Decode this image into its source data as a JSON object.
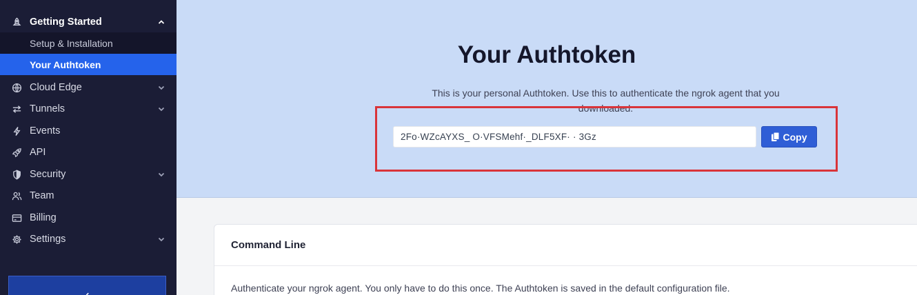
{
  "sidebar": {
    "section": {
      "label": "Getting Started",
      "icon": "rocket-icon"
    },
    "sub_items": [
      {
        "label": "Setup & Installation"
      },
      {
        "label": "Your Authtoken"
      }
    ],
    "items": [
      {
        "label": "Cloud Edge",
        "icon": "globe-icon"
      },
      {
        "label": "Tunnels",
        "icon": "arrows-icon"
      },
      {
        "label": "Events",
        "icon": "bolt-icon"
      },
      {
        "label": "API",
        "icon": "rocket-icon"
      },
      {
        "label": "Security",
        "icon": "shield-icon"
      },
      {
        "label": "Team",
        "icon": "team-icon"
      },
      {
        "label": "Billing",
        "icon": "card-icon"
      },
      {
        "label": "Settings",
        "icon": "gear-icon"
      }
    ]
  },
  "hero": {
    "title": "Your Authtoken",
    "description": "This is your personal Authtoken. Use this to authenticate the ngrok agent that you downloaded.",
    "token_value": "2Fo·WZcAYXS_          O·VFSMehf·_DLF5XF·     ·        3Gz",
    "copy_label": "Copy"
  },
  "card": {
    "title": "Command Line",
    "text": "Authenticate your ngrok agent. You only have to do this once. The Authtoken is saved in the default configuration file."
  },
  "colors": {
    "sidebar_bg": "#1b1d36",
    "active": "#2563eb",
    "hero_bg": "#c9dbf7",
    "highlight": "#d9343a",
    "button": "#2f5ed6"
  }
}
